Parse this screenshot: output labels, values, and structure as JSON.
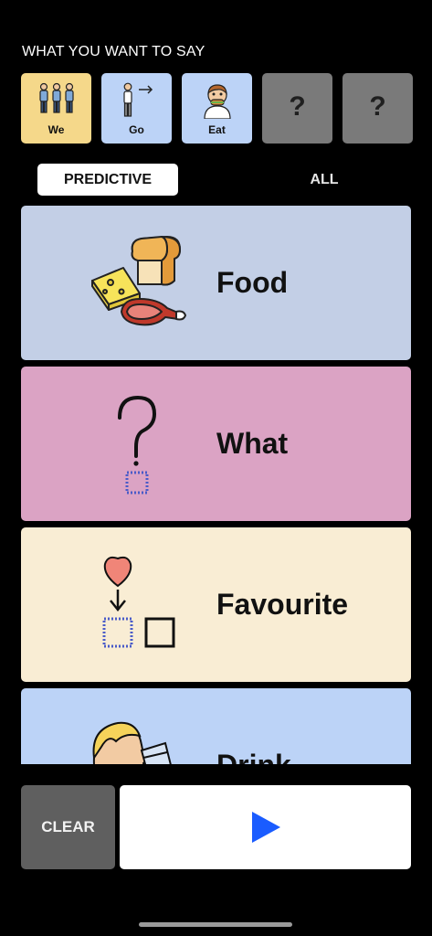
{
  "header": {
    "label": "WHAT YOU WANT TO SAY"
  },
  "sentence": {
    "tiles": [
      {
        "label": "We",
        "icon": "people-group-icon",
        "color": "#f5d88a"
      },
      {
        "label": "Go",
        "icon": "person-walking-arrow-icon",
        "color": "#bcd3f7"
      },
      {
        "label": "Eat",
        "icon": "person-eating-icon",
        "color": "#bcd3f7"
      }
    ],
    "placeholders": [
      "?",
      "?"
    ]
  },
  "tabs": {
    "predictive": "PREDICTIVE",
    "all": "ALL",
    "active": "PREDICTIVE"
  },
  "cards": [
    {
      "label": "Food",
      "icon": "food-cheese-bread-meat-icon",
      "color": "#c3cfe6"
    },
    {
      "label": "What",
      "icon": "question-mark-icon",
      "color": "#dba3c4"
    },
    {
      "label": "Favourite",
      "icon": "heart-favourite-icon",
      "color": "#f9edd4"
    },
    {
      "label": "Drink",
      "icon": "person-drinking-icon",
      "color": "#bcd3f7"
    }
  ],
  "controls": {
    "clear_label": "CLEAR",
    "speak_icon": "play-icon",
    "accent": "#1a5cff"
  }
}
